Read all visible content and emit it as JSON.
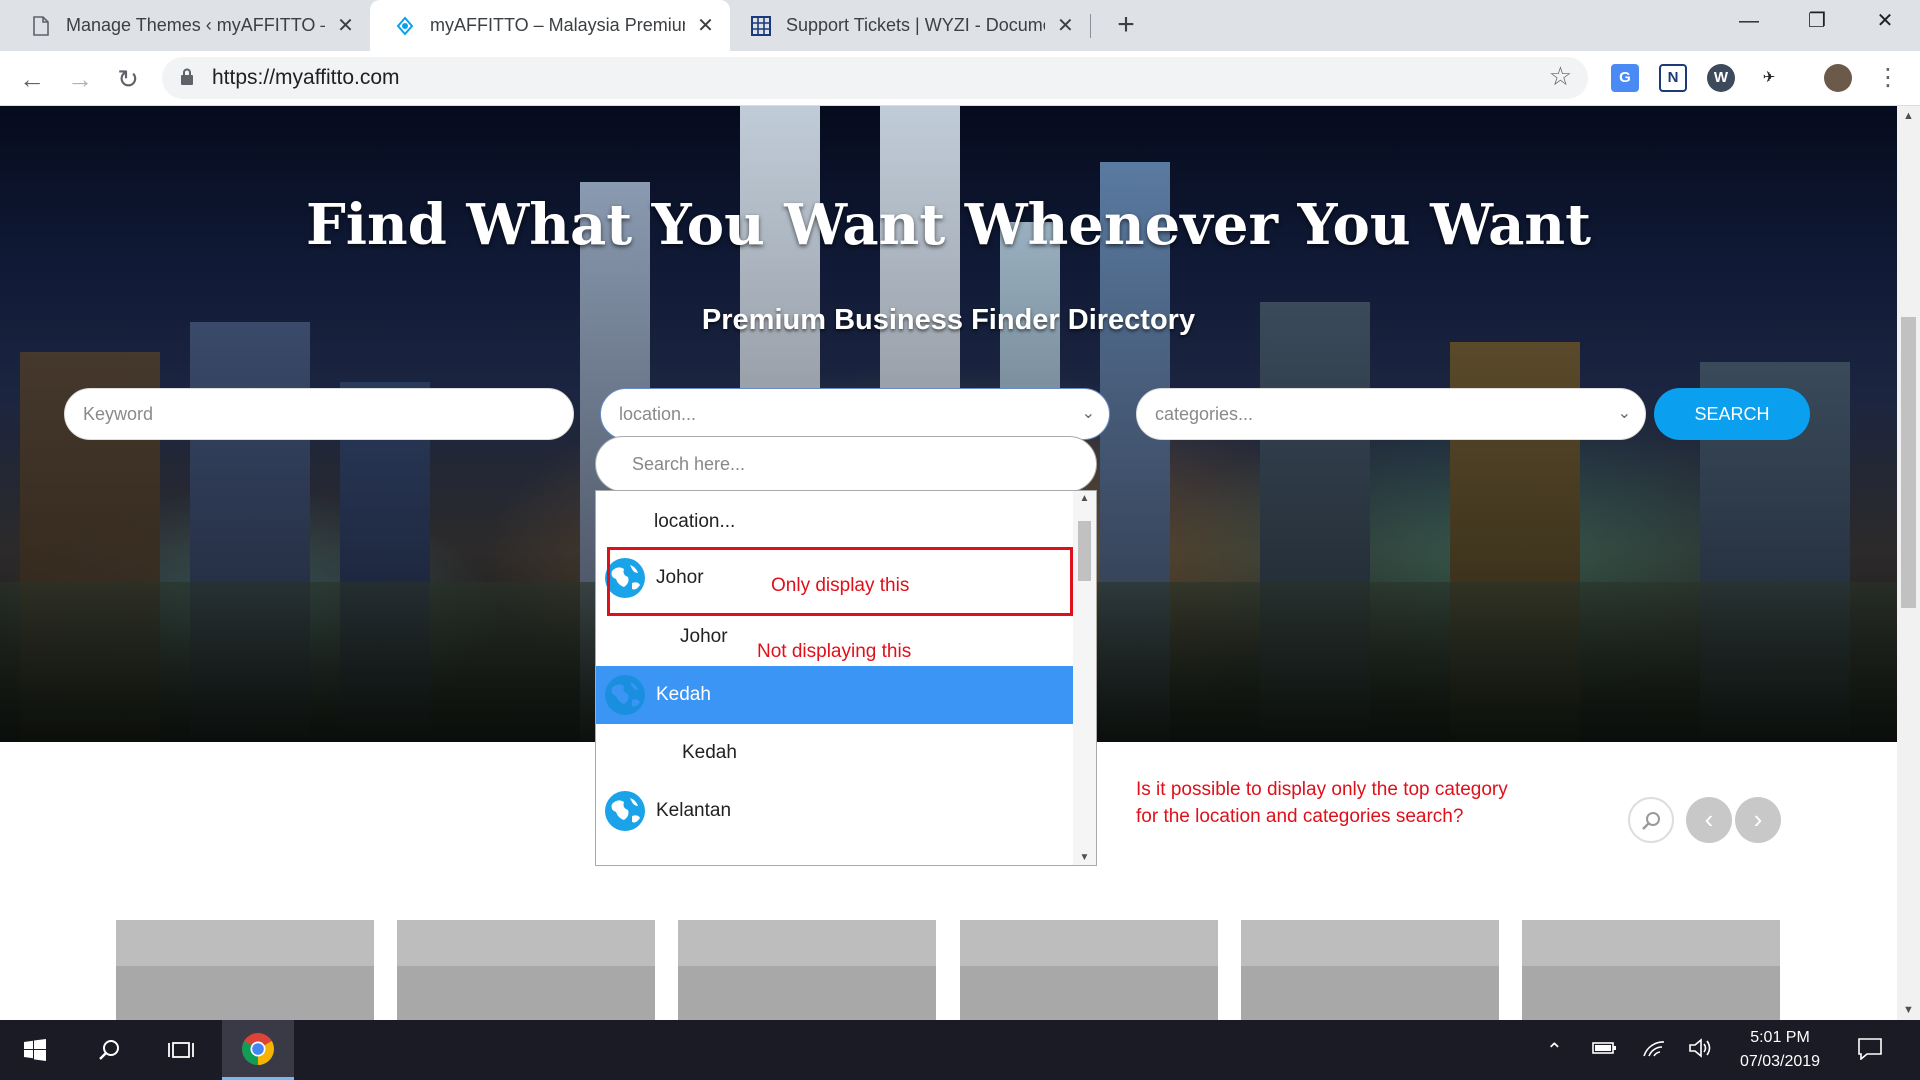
{
  "browser": {
    "tabs": [
      {
        "title": "Manage Themes ‹ myAFFITTO —",
        "icon": "document-icon",
        "active": false
      },
      {
        "title": "myAFFITTO – Malaysia Premium",
        "icon": "affitto-logo-icon",
        "active": true
      },
      {
        "title": "Support Tickets | WYZI - Docume",
        "icon": "grid-icon",
        "active": false
      }
    ],
    "url": "https://myaffitto.com"
  },
  "hero": {
    "title": "Find What You Want Whenever You Want",
    "subtitle": "Premium Business Finder Directory"
  },
  "search": {
    "keyword_placeholder": "Keyword",
    "location_placeholder": "location...",
    "categories_placeholder": "categories...",
    "button_label": "SEARCH",
    "dropdown_search_placeholder": "Search here..."
  },
  "dropdown": {
    "items": [
      {
        "label": "location...",
        "type": "placeholder"
      },
      {
        "label": "Johor",
        "type": "parent"
      },
      {
        "label": "Johor",
        "type": "child"
      },
      {
        "label": "Kedah",
        "type": "parent",
        "highlighted": true
      },
      {
        "label": "Kedah",
        "type": "child"
      },
      {
        "label": "Kelantan",
        "type": "parent"
      }
    ]
  },
  "annotations": {
    "only_display": "Only display this",
    "not_displaying": "Not displaying this",
    "question_line1": "Is it possible to display only the top category",
    "question_line2": "for the location and categories search?"
  },
  "taskbar": {
    "time": "5:01 PM",
    "date": "07/03/2019"
  },
  "colors": {
    "accent_blue": "#0aa0ef",
    "highlight_blue": "#3b95f5",
    "annotation_red": "#e0101a"
  }
}
